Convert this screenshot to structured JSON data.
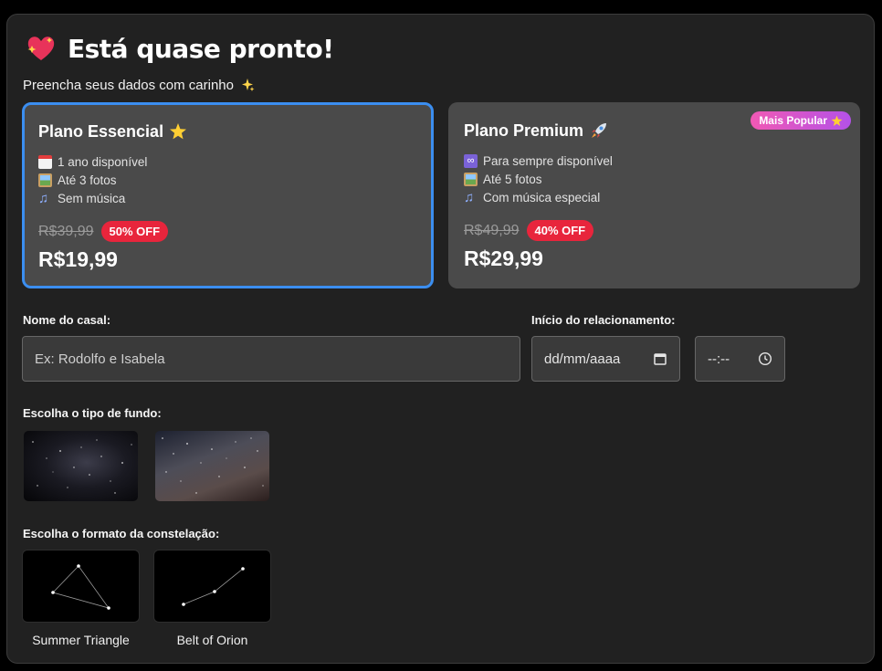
{
  "header": {
    "title": "Está quase pronto!",
    "subtitle": "Preencha seus dados com carinho"
  },
  "plans": [
    {
      "name": "Plano Essencial",
      "selected": true,
      "features": [
        {
          "icon": "calendar-icon",
          "text": "1 ano disponível"
        },
        {
          "icon": "photo-icon",
          "text": "Até 3 fotos"
        },
        {
          "icon": "music-note-icon",
          "text": "Sem música"
        }
      ],
      "old_price": "R$39,99",
      "discount": "50% OFF",
      "price": "R$19,99"
    },
    {
      "name": "Plano Premium",
      "selected": false,
      "badge": "Mais Popular",
      "features": [
        {
          "icon": "infinity-icon",
          "text": "Para sempre disponível"
        },
        {
          "icon": "photo-icon",
          "text": "Até 5 fotos"
        },
        {
          "icon": "music-note-icon",
          "text": "Com música especial"
        }
      ],
      "old_price": "R$49,99",
      "discount": "40% OFF",
      "price": "R$29,99"
    }
  ],
  "form": {
    "couple_label": "Nome do casal:",
    "couple_placeholder": "Ex: Rodolfo e Isabela",
    "start_label": "Início do relacionamento:",
    "date_placeholder": "dd/mm/aaaa",
    "time_placeholder": "--:--",
    "background_label": "Escolha o tipo de fundo:",
    "constellation_label": "Escolha o formato da constelação:"
  },
  "constellations": [
    {
      "name": "Summer Triangle"
    },
    {
      "name": "Belt of Orion"
    }
  ],
  "colors": {
    "selected_border": "#3b8ef0",
    "discount": "#e8253c",
    "badge_from": "#f159b4",
    "badge_to": "#b451e8"
  }
}
